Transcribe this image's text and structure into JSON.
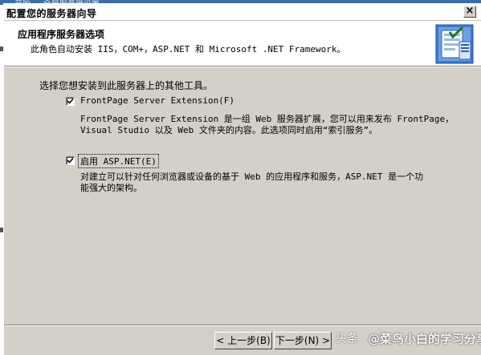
{
  "background": {
    "strip_text": "开始 ... 全局服务器设置 ..."
  },
  "window": {
    "title": "配置您的服务器向导",
    "close_glyph": "×"
  },
  "header": {
    "title": "应用程序服务器选项",
    "subtitle": "此角色自动安装 IIS，COM+，ASP.NET 和 Microsoft .NET Framework。",
    "icon": "wizard-server-icon"
  },
  "content": {
    "prompt": "选择您想安装到此服务器上的其他工具。",
    "options": [
      {
        "label": "FrontPage Server Extension(F)",
        "checked": true,
        "description": [
          "FrontPage Server Extension 是一组 Web 服务器扩展，您可以用来发布 FrontPage，",
          "Visual Studio 以及 Web 文件夹的内容。此选项同时启用“索引服务”。"
        ]
      },
      {
        "label": "启用 ASP.NET(E)",
        "checked": true,
        "focused": true,
        "description": [
          "对建立可以针对任何浏览器或设备的基于 Web 的应用程序和服务，ASP.NET 是一个功",
          "能强大的架构。"
        ]
      }
    ]
  },
  "buttons": {
    "back": "< 上一步(B)",
    "next": "下一步(N) >"
  },
  "watermark": {
    "logo": "头条",
    "text": "@菜鸟小白的学习分享"
  }
}
